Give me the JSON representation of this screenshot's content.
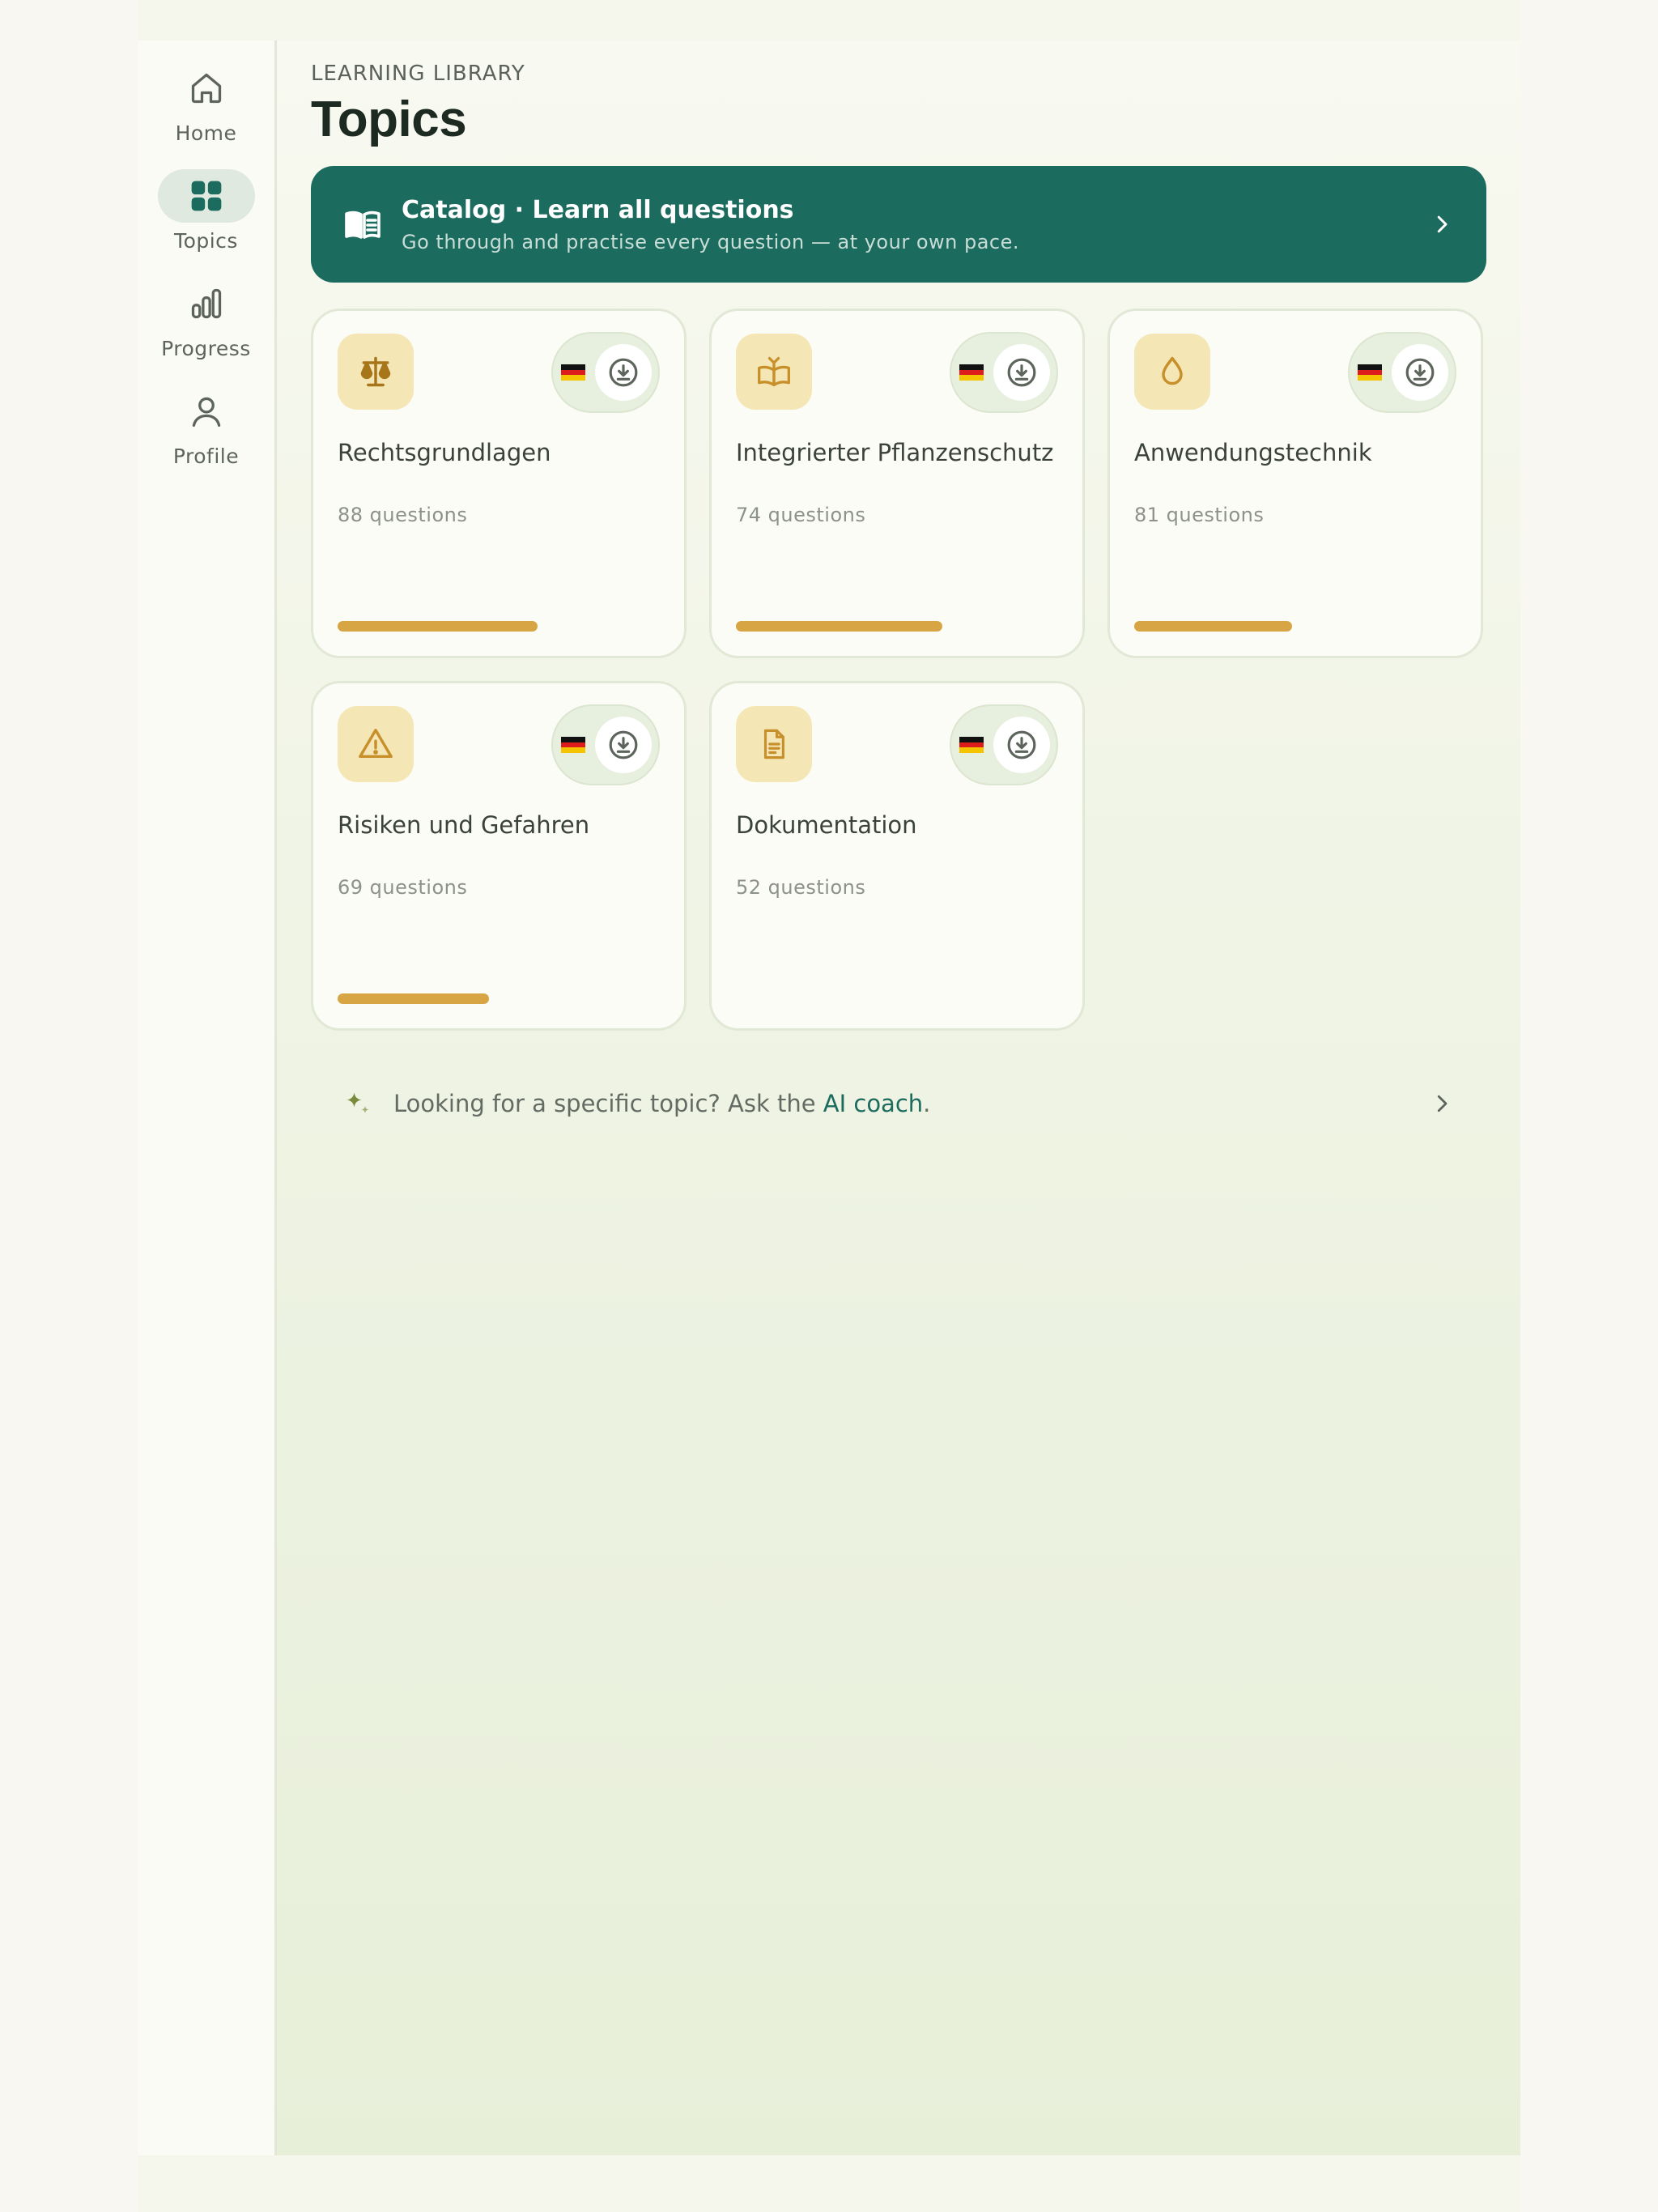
{
  "nav": [
    {
      "label": "Home",
      "icon": "home-icon",
      "active": false
    },
    {
      "label": "Topics",
      "icon": "grid-icon",
      "active": true
    },
    {
      "label": "Progress",
      "icon": "bar-chart-icon",
      "active": false
    },
    {
      "label": "Profile",
      "icon": "user-icon",
      "active": false
    }
  ],
  "header": {
    "eyebrow": "LEARNING LIBRARY",
    "title": "Topics"
  },
  "catalog": {
    "title": "Catalog · Learn all questions",
    "subtitle": "Go through and practise every question — at your own pace.",
    "icon": "open-book-icon"
  },
  "topics": [
    {
      "name": "Rechtsgrundlagen",
      "count": "88 questions",
      "icon": "scales-icon",
      "progress": 0.62
    },
    {
      "name": "Integrierter Pflanzenschutz",
      "count": "74 questions",
      "icon": "book-sprout-icon",
      "progress": 0.64
    },
    {
      "name": "Anwendungstechnik",
      "count": "81 questions",
      "icon": "droplet-icon",
      "progress": 0.49
    },
    {
      "name": "Risiken und Gefahren",
      "count": "69 questions",
      "icon": "warning-icon",
      "progress": 0.47
    },
    {
      "name": "Dokumentation",
      "count": "52 questions",
      "icon": "document-icon",
      "progress": 0
    }
  ],
  "coach": {
    "text": "Looking for a specific topic? Ask the ",
    "link": "AI coach",
    "suffix": ".",
    "icon": "sparkle-icon"
  },
  "colors": {
    "accent": "#1b6b5e",
    "progress": "#d8a544",
    "icon_tile": "#f5e6b6"
  }
}
